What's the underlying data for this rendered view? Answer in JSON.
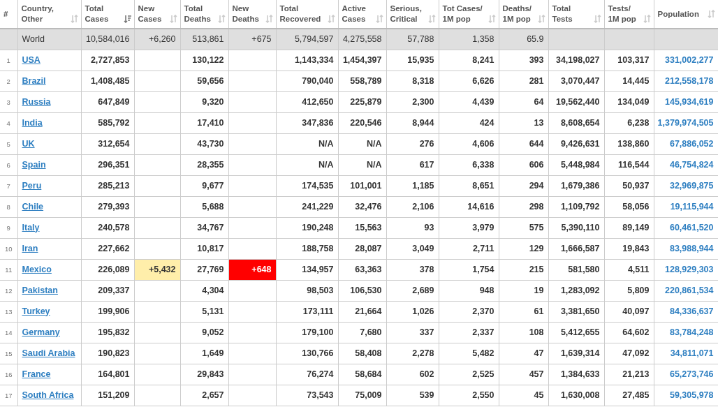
{
  "columns": [
    {
      "label": "#",
      "sortable": false
    },
    {
      "label": "Country,\nOther",
      "sortable": true,
      "sorted": false
    },
    {
      "label": "Total\nCases",
      "sortable": true,
      "sorted": true
    },
    {
      "label": "New\nCases",
      "sortable": true,
      "sorted": false
    },
    {
      "label": "Total\nDeaths",
      "sortable": true,
      "sorted": false
    },
    {
      "label": "New\nDeaths",
      "sortable": true,
      "sorted": false
    },
    {
      "label": "Total\nRecovered",
      "sortable": true,
      "sorted": false
    },
    {
      "label": "Active\nCases",
      "sortable": true,
      "sorted": false
    },
    {
      "label": "Serious,\nCritical",
      "sortable": true,
      "sorted": false
    },
    {
      "label": "Tot Cases/\n1M pop",
      "sortable": true,
      "sorted": false
    },
    {
      "label": "Deaths/\n1M pop",
      "sortable": true,
      "sorted": false
    },
    {
      "label": "Total\nTests",
      "sortable": true,
      "sorted": false
    },
    {
      "label": "Tests/\n1M pop",
      "sortable": true,
      "sorted": false
    },
    {
      "label": "Population",
      "sortable": true,
      "sorted": false
    }
  ],
  "world": {
    "country": "World",
    "total_cases": "10,584,016",
    "new_cases": "+6,260",
    "total_deaths": "513,861",
    "new_deaths": "+675",
    "total_recovered": "5,794,597",
    "active_cases": "4,275,558",
    "serious": "57,788",
    "cases_per_1m": "1,358",
    "deaths_per_1m": "65.9"
  },
  "rows": [
    {
      "num": "1",
      "country": "USA",
      "total_cases": "2,727,853",
      "total_deaths": "130,122",
      "total_recovered": "1,143,334",
      "active_cases": "1,454,397",
      "serious": "15,935",
      "cases_per_1m": "8,241",
      "deaths_per_1m": "393",
      "total_tests": "34,198,027",
      "tests_per_1m": "103,317",
      "population": "331,002,277",
      "flagged": false
    },
    {
      "num": "2",
      "country": "Brazil",
      "total_cases": "1,408,485",
      "total_deaths": "59,656",
      "total_recovered": "790,040",
      "active_cases": "558,789",
      "serious": "8,318",
      "cases_per_1m": "6,626",
      "deaths_per_1m": "281",
      "total_tests": "3,070,447",
      "tests_per_1m": "14,445",
      "population": "212,558,178",
      "flagged": false
    },
    {
      "num": "3",
      "country": "Russia",
      "total_cases": "647,849",
      "total_deaths": "9,320",
      "total_recovered": "412,650",
      "active_cases": "225,879",
      "serious": "2,300",
      "cases_per_1m": "4,439",
      "deaths_per_1m": "64",
      "total_tests": "19,562,440",
      "tests_per_1m": "134,049",
      "population": "145,934,619",
      "flagged": false
    },
    {
      "num": "4",
      "country": "India",
      "total_cases": "585,792",
      "total_deaths": "17,410",
      "total_recovered": "347,836",
      "active_cases": "220,546",
      "serious": "8,944",
      "cases_per_1m": "424",
      "deaths_per_1m": "13",
      "total_tests": "8,608,654",
      "tests_per_1m": "6,238",
      "population": "1,379,974,505",
      "flagged": false
    },
    {
      "num": "5",
      "country": "UK",
      "total_cases": "312,654",
      "total_deaths": "43,730",
      "total_recovered": "N/A",
      "active_cases": "N/A",
      "serious": "276",
      "cases_per_1m": "4,606",
      "deaths_per_1m": "644",
      "total_tests": "9,426,631",
      "tests_per_1m": "138,860",
      "population": "67,886,052",
      "flagged": false
    },
    {
      "num": "6",
      "country": "Spain",
      "total_cases": "296,351",
      "total_deaths": "28,355",
      "total_recovered": "N/A",
      "active_cases": "N/A",
      "serious": "617",
      "cases_per_1m": "6,338",
      "deaths_per_1m": "606",
      "total_tests": "5,448,984",
      "tests_per_1m": "116,544",
      "population": "46,754,824",
      "flagged": false
    },
    {
      "num": "7",
      "country": "Peru",
      "total_cases": "285,213",
      "total_deaths": "9,677",
      "total_recovered": "174,535",
      "active_cases": "101,001",
      "serious": "1,185",
      "cases_per_1m": "8,651",
      "deaths_per_1m": "294",
      "total_tests": "1,679,386",
      "tests_per_1m": "50,937",
      "population": "32,969,875",
      "flagged": false
    },
    {
      "num": "8",
      "country": "Chile",
      "total_cases": "279,393",
      "total_deaths": "5,688",
      "total_recovered": "241,229",
      "active_cases": "32,476",
      "serious": "2,106",
      "cases_per_1m": "14,616",
      "deaths_per_1m": "298",
      "total_tests": "1,109,792",
      "tests_per_1m": "58,056",
      "population": "19,115,944",
      "flagged": false
    },
    {
      "num": "9",
      "country": "Italy",
      "total_cases": "240,578",
      "total_deaths": "34,767",
      "total_recovered": "190,248",
      "active_cases": "15,563",
      "serious": "93",
      "cases_per_1m": "3,979",
      "deaths_per_1m": "575",
      "total_tests": "5,390,110",
      "tests_per_1m": "89,149",
      "population": "60,461,520",
      "flagged": false
    },
    {
      "num": "10",
      "country": "Iran",
      "total_cases": "227,662",
      "total_deaths": "10,817",
      "total_recovered": "188,758",
      "active_cases": "28,087",
      "serious": "3,049",
      "cases_per_1m": "2,711",
      "deaths_per_1m": "129",
      "total_tests": "1,666,587",
      "tests_per_1m": "19,843",
      "population": "83,988,944",
      "flagged": false
    },
    {
      "num": "11",
      "country": "Mexico",
      "total_cases": "226,089",
      "new_cases": "+5,432",
      "total_deaths": "27,769",
      "new_deaths": "+648",
      "total_recovered": "134,957",
      "active_cases": "63,363",
      "serious": "378",
      "cases_per_1m": "1,754",
      "deaths_per_1m": "215",
      "total_tests": "581,580",
      "tests_per_1m": "4,511",
      "population": "128,929,303",
      "flagged": true
    },
    {
      "num": "12",
      "country": "Pakistan",
      "total_cases": "209,337",
      "total_deaths": "4,304",
      "total_recovered": "98,503",
      "active_cases": "106,530",
      "serious": "2,689",
      "cases_per_1m": "948",
      "deaths_per_1m": "19",
      "total_tests": "1,283,092",
      "tests_per_1m": "5,809",
      "population": "220,861,534",
      "flagged": false
    },
    {
      "num": "13",
      "country": "Turkey",
      "total_cases": "199,906",
      "total_deaths": "5,131",
      "total_recovered": "173,111",
      "active_cases": "21,664",
      "serious": "1,026",
      "cases_per_1m": "2,370",
      "deaths_per_1m": "61",
      "total_tests": "3,381,650",
      "tests_per_1m": "40,097",
      "population": "84,336,637",
      "flagged": false
    },
    {
      "num": "14",
      "country": "Germany",
      "total_cases": "195,832",
      "total_deaths": "9,052",
      "total_recovered": "179,100",
      "active_cases": "7,680",
      "serious": "337",
      "cases_per_1m": "2,337",
      "deaths_per_1m": "108",
      "total_tests": "5,412,655",
      "tests_per_1m": "64,602",
      "population": "83,784,248",
      "flagged": false
    },
    {
      "num": "15",
      "country": "Saudi Arabia",
      "total_cases": "190,823",
      "total_deaths": "1,649",
      "total_recovered": "130,766",
      "active_cases": "58,408",
      "serious": "2,278",
      "cases_per_1m": "5,482",
      "deaths_per_1m": "47",
      "total_tests": "1,639,314",
      "tests_per_1m": "47,092",
      "population": "34,811,071",
      "flagged": false
    },
    {
      "num": "16",
      "country": "France",
      "total_cases": "164,801",
      "total_deaths": "29,843",
      "total_recovered": "76,274",
      "active_cases": "58,684",
      "serious": "602",
      "cases_per_1m": "2,525",
      "deaths_per_1m": "457",
      "total_tests": "1,384,633",
      "tests_per_1m": "21,213",
      "population": "65,273,746",
      "flagged": false
    },
    {
      "num": "17",
      "country": "South Africa",
      "total_cases": "151,209",
      "total_deaths": "2,657",
      "total_recovered": "73,543",
      "active_cases": "75,009",
      "serious": "539",
      "cases_per_1m": "2,550",
      "deaths_per_1m": "45",
      "total_tests": "1,630,008",
      "tests_per_1m": "27,485",
      "population": "59,305,978",
      "flagged": false
    }
  ]
}
